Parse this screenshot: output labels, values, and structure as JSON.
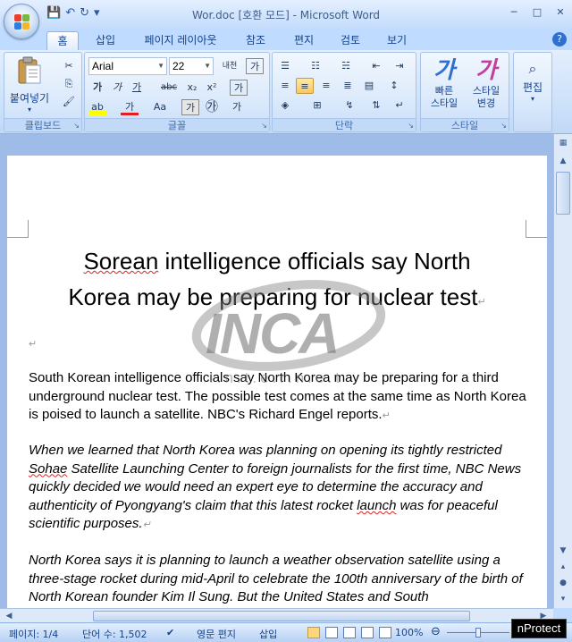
{
  "window": {
    "title": "Wor.doc [호환 모드] - Microsoft Word",
    "minimize": "─",
    "maximize": "□",
    "close": "✕"
  },
  "qat": {
    "save": "💾",
    "undo": "↶",
    "redo": "↻",
    "customize": "▾"
  },
  "tabs": [
    {
      "label": "홈",
      "active": true
    },
    {
      "label": "삽입"
    },
    {
      "label": "페이지 레이아웃"
    },
    {
      "label": "참조"
    },
    {
      "label": "편지"
    },
    {
      "label": "검토"
    },
    {
      "label": "보기"
    }
  ],
  "ribbon": {
    "clipboard": {
      "label": "클립보드",
      "paste": "붙여넣기",
      "paste_arrow": "▾"
    },
    "font": {
      "label": "글꼴",
      "font_name": "Arial",
      "font_size": "22",
      "grow": "내천",
      "clear": "가",
      "bold": "가",
      "italic": "가",
      "underline": "가",
      "strike": "abc",
      "subscript": "x₂",
      "superscript": "x²",
      "change_case": "Aa",
      "char_border": "가",
      "enclosed": "㉮",
      "phonetic": "가",
      "highlight": "ab",
      "font_color": "가"
    },
    "paragraph": {
      "label": "단락"
    },
    "styles": {
      "label": "스타일",
      "quick_styles": "빠른\n스타일",
      "change_styles": "스타일\n변경",
      "quick_glyph": "가",
      "change_glyph": "가"
    },
    "editing": {
      "label": "편집"
    }
  },
  "document": {
    "title_line1": "Sorean intelligence officials say North",
    "title_line2": "Korea may be preparing for nuclear test",
    "title_mark": "↵",
    "empty_mark": "↵",
    "para1": "South Korean intelligence officials say North Korea may be preparing for a third underground nuclear test. The possible test comes at the same time as North Korea is poised to launch a satellite. NBC's Richard Engel reports.",
    "para2": "When we learned that North Korea was planning on opening its tightly restricted Sohae Satellite Launching Center to foreign journalists for the first time, NBC News quickly decided we would need an expert eye to determine the accuracy and authenticity of Pyongyang's claim that this latest rocket launch was for peaceful scientific purposes.",
    "para3": "North Korea says it is planning to launch a weather observation satellite using a three-stage rocket during mid-April to celebrate the 100th anniversary of the birth of North Korean founder Kim Il Sung. But the United States and South",
    "para_mark": "↵",
    "watermark_logo": "INCA",
    "watermark_sub": "I.n.t.e.r.n.e.t"
  },
  "status": {
    "page": "페이지: 1/4",
    "words": "단어 수: 1,502",
    "language": "영문 편지",
    "mode": "삽입",
    "zoom": "100%",
    "zoom_minus": "⊖",
    "zoom_plus": "⊕"
  },
  "nprotect": "nProtect",
  "colors": {
    "accent": "#15428b",
    "highlight": "#fbc660",
    "font_red": "#e02020"
  }
}
